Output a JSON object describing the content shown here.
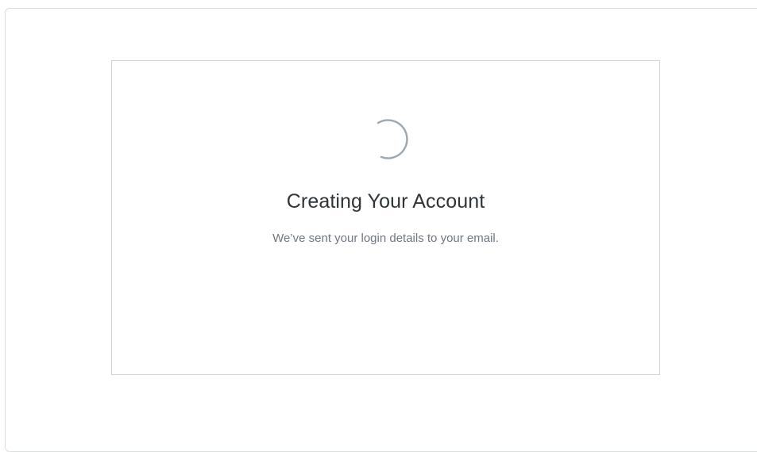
{
  "status": {
    "title": "Creating Your Account",
    "message": "We’ve sent your login details to your email.",
    "icon": "spinner-icon"
  },
  "colors": {
    "spinner": "#9ea7b1",
    "title": "#2f3438",
    "message": "#6f7780",
    "border": "#cfd3d8"
  }
}
